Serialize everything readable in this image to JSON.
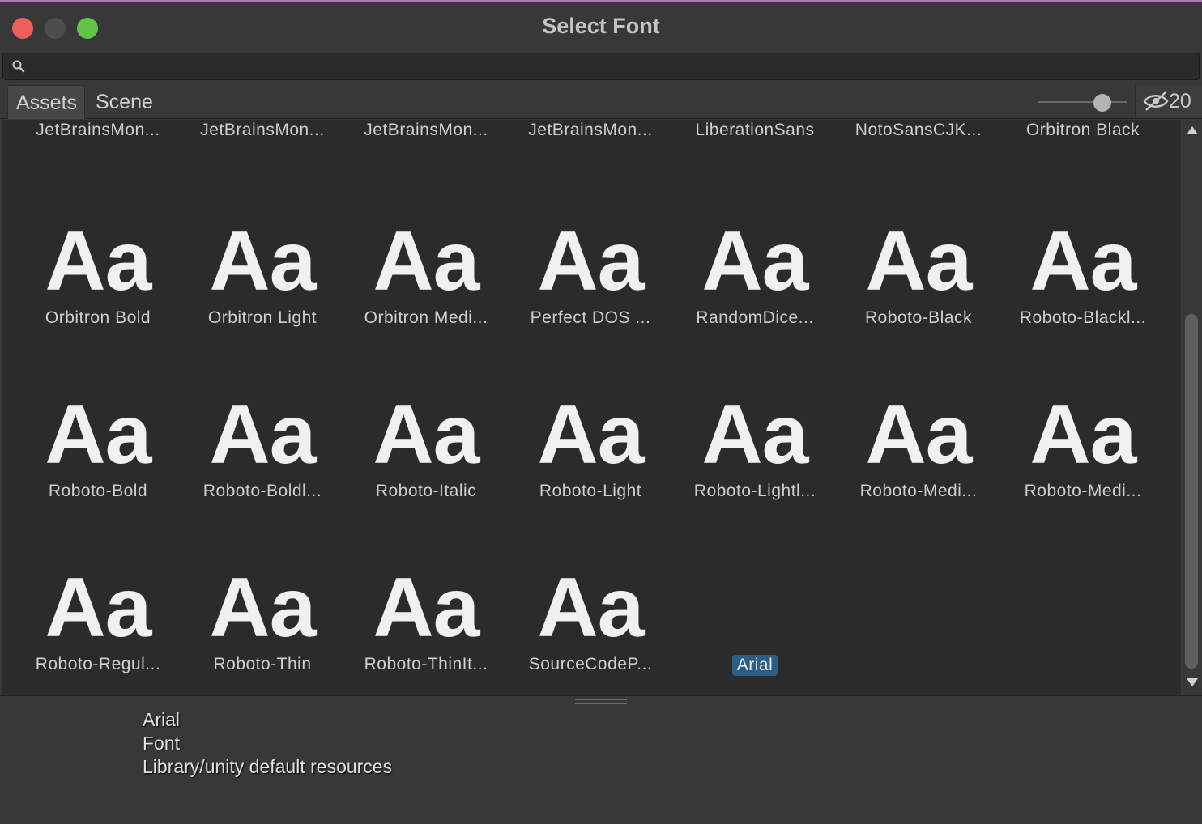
{
  "window": {
    "title": "Select Font"
  },
  "search": {
    "value": "",
    "placeholder": ""
  },
  "tabs": {
    "assets": "Assets",
    "scene": "Scene"
  },
  "toolbar": {
    "size_slider_level": 0.73,
    "hidden_count": "20"
  },
  "grid": {
    "preview_glyph": "Aa",
    "rows": [
      [
        "JetBrainsMon...",
        "JetBrainsMon...",
        "JetBrainsMon...",
        "JetBrainsMon...",
        "LiberationSans",
        "NotoSansCJK...",
        "Orbitron Black"
      ],
      [
        "Orbitron Bold",
        "Orbitron Light",
        "Orbitron Medi...",
        "Perfect DOS ...",
        "RandomDice...",
        "Roboto-Black",
        "Roboto-Blackl..."
      ],
      [
        "Roboto-Bold",
        "Roboto-Boldl...",
        "Roboto-Italic",
        "Roboto-Light",
        "Roboto-Lightl...",
        "Roboto-Medi...",
        "Roboto-Medi..."
      ],
      [
        "Roboto-Regul...",
        "Roboto-Thin",
        "Roboto-ThinIt...",
        "SourceCodeP...",
        "Arial"
      ]
    ],
    "selected": "Arial"
  },
  "details": {
    "name": "Arial",
    "type": "Font",
    "path": "Library/unity default resources"
  },
  "colors": {
    "close": "#ee5f57",
    "minimize": "#4d4d4d",
    "maximize": "#5fc549",
    "selection": "#2c5d87"
  }
}
